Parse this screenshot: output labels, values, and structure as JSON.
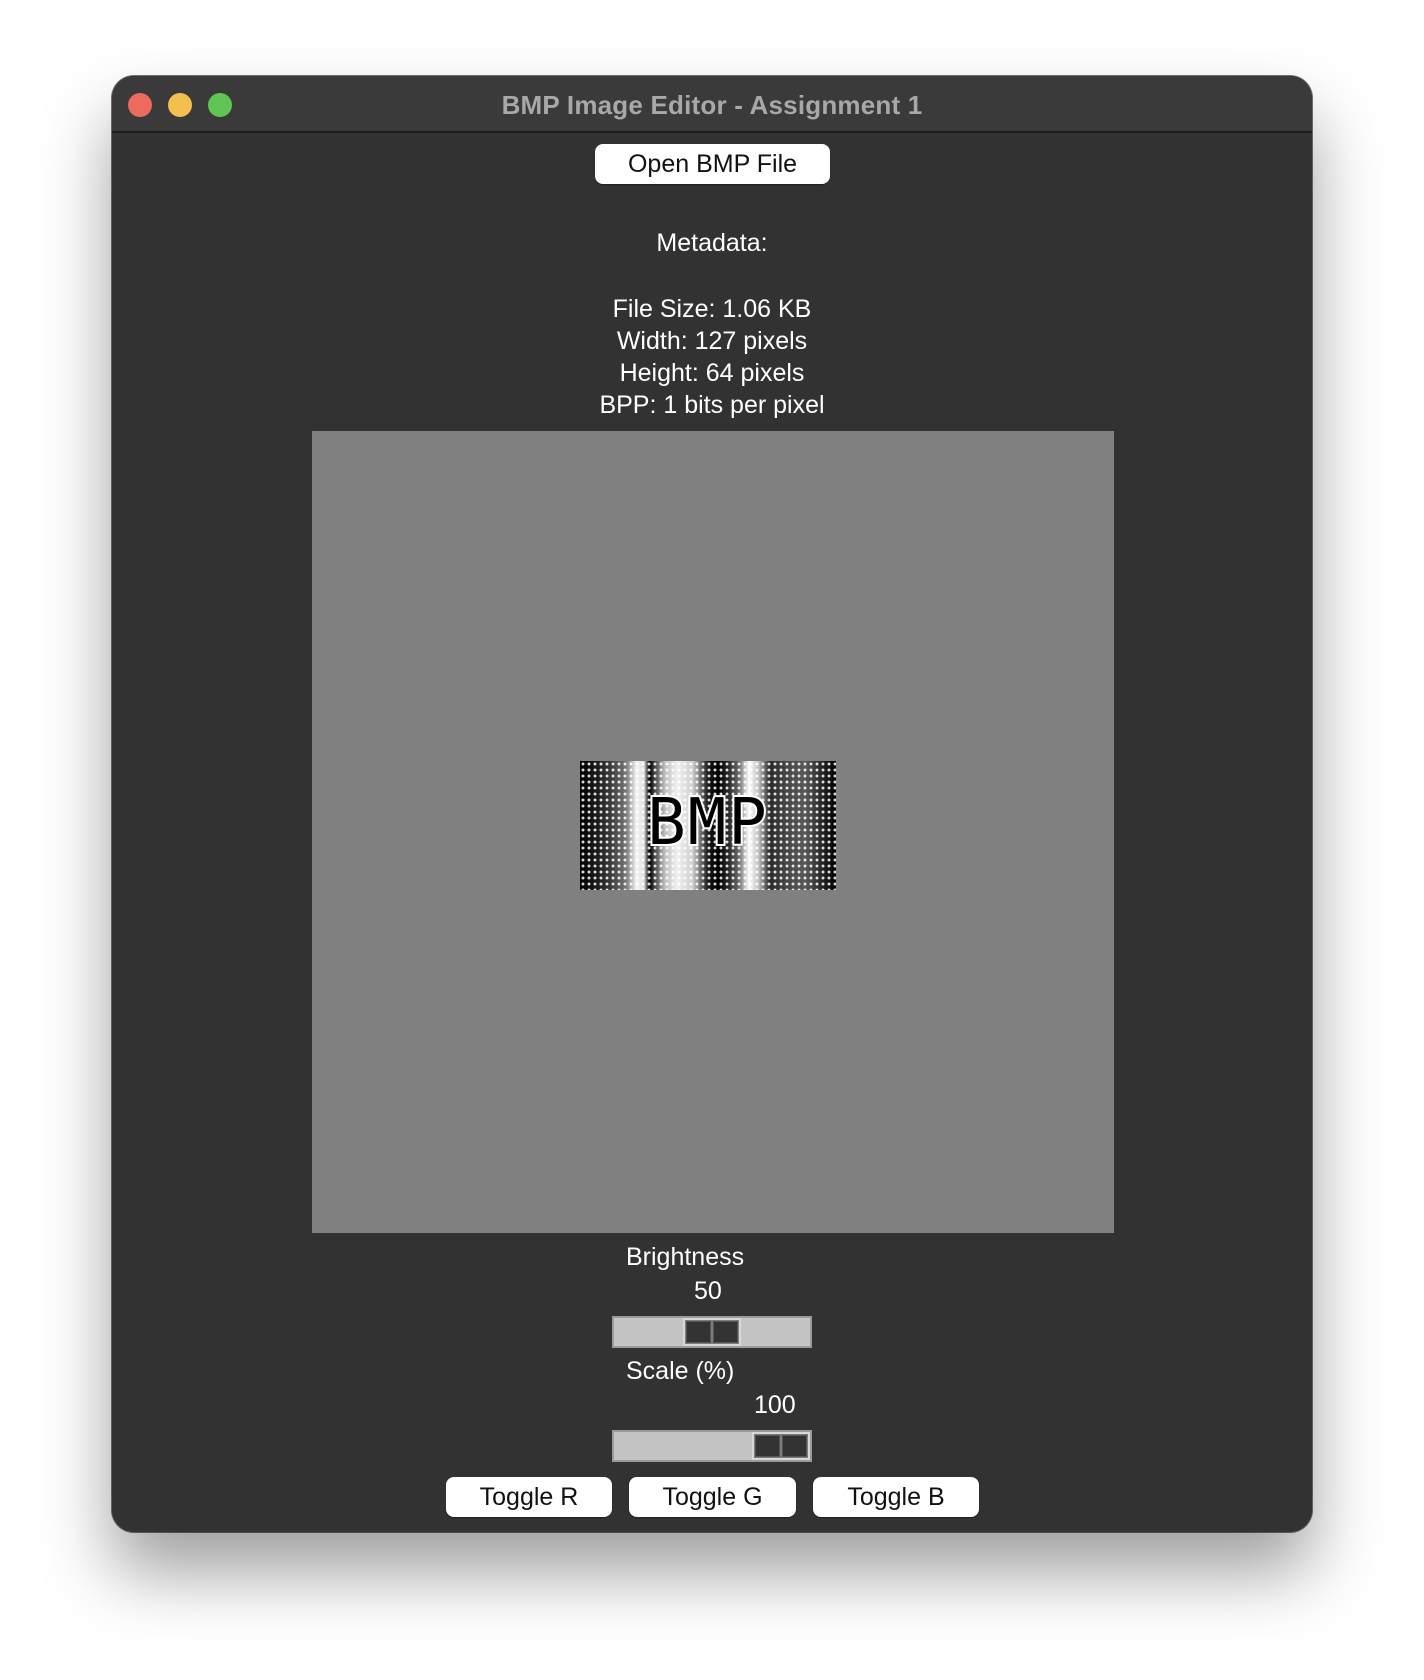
{
  "window": {
    "title": "BMP Image Editor - Assignment 1"
  },
  "toolbar": {
    "open_label": "Open BMP File"
  },
  "metadata": {
    "heading": "Metadata:",
    "file_size": "File Size: 1.06 KB",
    "width": "Width: 127 pixels",
    "height": "Height: 64 pixels",
    "bpp": "BPP: 1 bits per pixel"
  },
  "preview": {
    "image_text": "BMP",
    "canvas_color": "#808080"
  },
  "controls": {
    "brightness": {
      "label": "Brightness",
      "value": "50",
      "fraction": 0.5
    },
    "scale": {
      "label": "Scale (%)",
      "value": "100",
      "fraction": 1.0
    },
    "toggles": [
      "Toggle R",
      "Toggle G",
      "Toggle B"
    ]
  },
  "colors": {
    "window_bg": "#323232",
    "titlebar_bg": "#3a3a3a",
    "close": "#ed6a5e",
    "minimize": "#f4bf4f",
    "maximize": "#61c554"
  }
}
